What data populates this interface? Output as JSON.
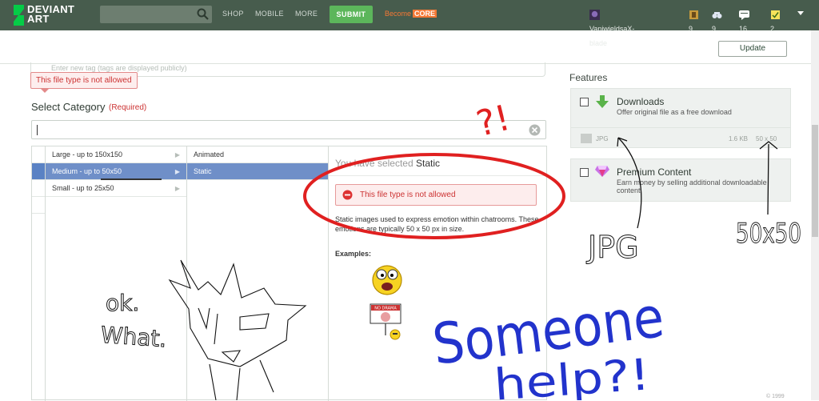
{
  "topbar": {
    "logo_line1": "DEVIANT",
    "logo_line2": "ART",
    "nav": [
      "SHOP",
      "MOBILE",
      "MORE"
    ],
    "submit_label": "SUBMIT",
    "become_label": "Become",
    "core_label": "CORE",
    "username": "VaniwieldsaX-blade",
    "stats": [
      {
        "icon": "watch-icon",
        "count": "9"
      },
      {
        "icon": "binoculars-icon",
        "count": "9"
      },
      {
        "icon": "notes-icon",
        "count": "16"
      },
      {
        "icon": "message-icon",
        "count": "2"
      }
    ]
  },
  "update_label": "Update",
  "tags": {
    "placeholder": "Enter new tag (tags are displayed publicly)",
    "error": "This file type is not allowed"
  },
  "category": {
    "label": "Select Category",
    "required": "(Required)",
    "value": ""
  },
  "picker": {
    "col1": [
      {
        "label": "Large - up to 150x150",
        "selected": false
      },
      {
        "label": "Medium - up to 50x50",
        "selected": true
      },
      {
        "label": "Small - up to 25x50",
        "selected": false
      }
    ],
    "col2": [
      {
        "label": "Animated",
        "selected": false
      },
      {
        "label": "Static",
        "selected": true
      }
    ],
    "detail": {
      "prefix": "You have selected",
      "selected": "Static",
      "error": "This file type is not allowed",
      "description": "Static images used to express emotion within chatrooms. These emotions are typically 50 x 50 px in size.",
      "examples_label": "Examples:",
      "example2_text": "NO DRAMA"
    }
  },
  "features": {
    "label": "Features",
    "downloads": {
      "title": "Downloads",
      "desc": "Offer original file as a free download",
      "filetype": "JPG",
      "size": "1.6 KB",
      "dims": "50 x 50"
    },
    "premium": {
      "title": "Premium Content",
      "desc": "Earn money by selling additional downloadable content"
    }
  },
  "footer_text": "© 1999",
  "scribbles": {
    "question": "?!",
    "ok": "ok.",
    "what": "What.",
    "jpg": "JPG",
    "size": "50x50",
    "someone": "Someone",
    "help": "help?!"
  },
  "colors": {
    "topbar": "#475c4d",
    "submit": "#5cb65b",
    "core": "#f47835",
    "selected_row": "#6f8fc8",
    "error": "#cc3333",
    "red_ink": "#e02020",
    "blue_ink": "#2233cc"
  }
}
